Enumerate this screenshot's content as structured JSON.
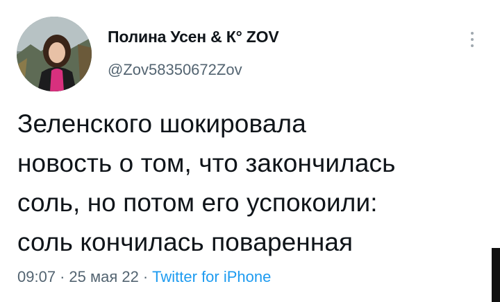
{
  "author": {
    "name": "Полина Усен & К° ZOV",
    "handle": "@Zov58350672Zov"
  },
  "tweet": {
    "text": "Зеленского шокировала\nновость о том, что закончилась\nсоль, но потом его успокоили:\nсоль кончилась поваренная",
    "time": "09:07",
    "date": "25 мая 22",
    "separator": "·",
    "source": "Twitter for iPhone"
  },
  "icons": {
    "more": "more-vertical-icon",
    "avatar": "avatar-photo"
  },
  "colors": {
    "text": "#0f1419",
    "secondary": "#536471",
    "link": "#1d9bf0"
  }
}
